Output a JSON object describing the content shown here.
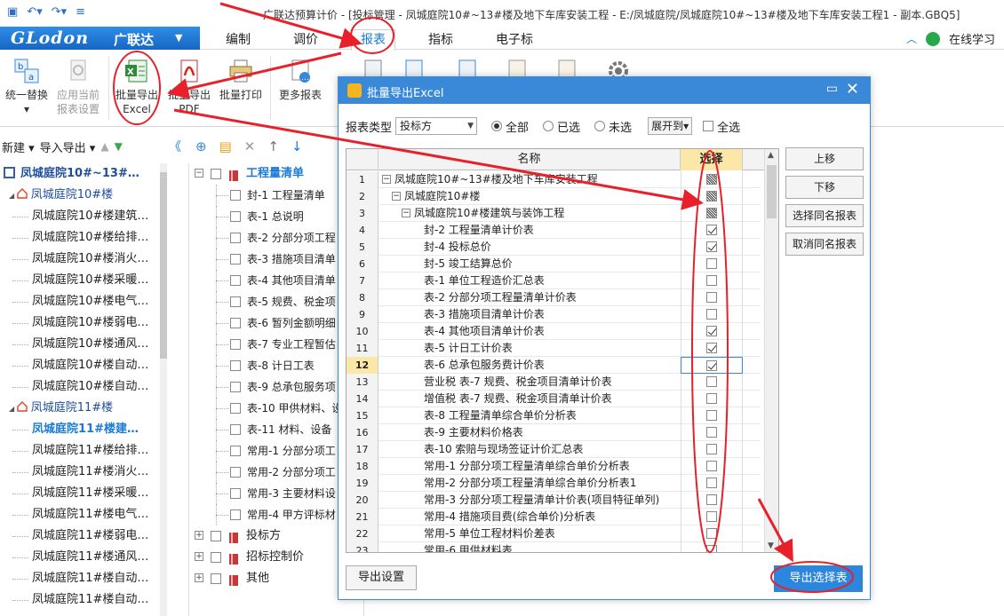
{
  "window": {
    "title": "广联达预算计价 - [投标管理 - 凤城庭院10#~13#楼及地下车库安装工程 - E:/凤城庭院/凤城庭院10#~13#楼及地下车库安装工程1 - 副本.GBQ5]"
  },
  "brand": {
    "logo": "GLodon",
    "name": "广联达"
  },
  "menu": {
    "tabs": [
      "编制",
      "调价",
      "报表",
      "指标",
      "电子标"
    ],
    "active": "报表",
    "learn": "在线学习"
  },
  "ribbon": {
    "buttons": [
      {
        "label1": "统一替换",
        "label2": "▾"
      },
      {
        "label1": "应用当前",
        "label2": "报表设置"
      },
      {
        "label1": "批量导出",
        "label2": "Excel"
      },
      {
        "label1": "批量导出",
        "label2": "PDF"
      },
      {
        "label1": "批量打印",
        "label2": ""
      },
      {
        "label1": "更多报表",
        "label2": ""
      }
    ]
  },
  "left_toolbar": {
    "new": "新建 ▾",
    "import_export": "导入导出 ▾"
  },
  "left_tree": [
    {
      "level": 0,
      "label": "凤城庭院10#~13#…"
    },
    {
      "level": 1,
      "label": "凤城庭院10#楼"
    },
    {
      "level": 2,
      "label": "凤城庭院10#楼建筑…"
    },
    {
      "level": 2,
      "label": "凤城庭院10#楼给排…"
    },
    {
      "level": 2,
      "label": "凤城庭院10#楼消火…"
    },
    {
      "level": 2,
      "label": "凤城庭院10#楼采暖…"
    },
    {
      "level": 2,
      "label": "凤城庭院10#楼电气…"
    },
    {
      "level": 2,
      "label": "凤城庭院10#楼弱电…"
    },
    {
      "level": 2,
      "label": "凤城庭院10#楼通风…"
    },
    {
      "level": 2,
      "label": "凤城庭院10#楼自动…"
    },
    {
      "level": 2,
      "label": "凤城庭院10#楼自动…"
    },
    {
      "level": 1,
      "label": "凤城庭院11#楼"
    },
    {
      "level": 2,
      "label": "凤城庭院11#楼建…",
      "selected": true
    },
    {
      "level": 2,
      "label": "凤城庭院11#楼给排…"
    },
    {
      "level": 2,
      "label": "凤城庭院11#楼消火…"
    },
    {
      "level": 2,
      "label": "凤城庭院11#楼采暖…"
    },
    {
      "level": 2,
      "label": "凤城庭院11#楼电气…"
    },
    {
      "level": 2,
      "label": "凤城庭院11#楼弱电…"
    },
    {
      "level": 2,
      "label": "凤城庭院11#楼通风…"
    },
    {
      "level": 2,
      "label": "凤城庭院11#楼自动…"
    },
    {
      "level": 2,
      "label": "凤城庭院11#楼自动…"
    }
  ],
  "mid_tree": [
    {
      "level": 0,
      "label": "工程量清单",
      "expanded": true,
      "highlight": true
    },
    {
      "level": 1,
      "label": "封-1 工程量清单"
    },
    {
      "level": 1,
      "label": "表-1 总说明"
    },
    {
      "level": 1,
      "label": "表-2 分部分项工程"
    },
    {
      "level": 1,
      "label": "表-3 措施项目清单"
    },
    {
      "level": 1,
      "label": "表-4 其他项目清单"
    },
    {
      "level": 1,
      "label": "表-5 规费、税金项"
    },
    {
      "level": 1,
      "label": "表-6 暂列金额明细"
    },
    {
      "level": 1,
      "label": "表-7 专业工程暂估"
    },
    {
      "level": 1,
      "label": "表-8 计日工表"
    },
    {
      "level": 1,
      "label": "表-9 总承包服务项"
    },
    {
      "level": 1,
      "label": "表-10 甲供材料、设"
    },
    {
      "level": 1,
      "label": "表-11 材料、设备"
    },
    {
      "level": 1,
      "label": "常用-1 分部分项工"
    },
    {
      "level": 1,
      "label": "常用-2 分部分项工"
    },
    {
      "level": 1,
      "label": "常用-3 主要材料设"
    },
    {
      "level": 1,
      "label": "常用-4 甲方评标材"
    },
    {
      "level": 0,
      "label": "投标方",
      "expanded": false
    },
    {
      "level": 0,
      "label": "招标控制价",
      "expanded": false
    },
    {
      "level": 0,
      "label": "其他",
      "expanded": false
    }
  ],
  "dialog": {
    "title": "批量导出Excel",
    "report_type_label": "报表类型",
    "report_type_value": "投标方",
    "radio_all": "全部",
    "radio_selected": "已选",
    "radio_unselected": "未选",
    "expand_to": "展开到",
    "select_all": "全选",
    "col_name": "名称",
    "col_select": "选择",
    "rows": [
      {
        "n": "1",
        "indent": 0,
        "pm": "−",
        "label": "凤城庭院10#~13#楼及地下车库安装工程",
        "state": "part"
      },
      {
        "n": "2",
        "indent": 1,
        "pm": "−",
        "label": "凤城庭院10#楼",
        "state": "part"
      },
      {
        "n": "3",
        "indent": 2,
        "pm": "−",
        "label": "凤城庭院10#楼建筑与装饰工程",
        "state": "part"
      },
      {
        "n": "4",
        "indent": 3,
        "label": "封-2 工程量清单计价表",
        "state": "on"
      },
      {
        "n": "5",
        "indent": 3,
        "label": "封-4 投标总价",
        "state": "on"
      },
      {
        "n": "6",
        "indent": 3,
        "label": "封-5 竣工结算总价",
        "state": "off"
      },
      {
        "n": "7",
        "indent": 3,
        "label": "表-1 单位工程造价汇总表",
        "state": "off"
      },
      {
        "n": "8",
        "indent": 3,
        "label": "表-2 分部分项工程量清单计价表",
        "state": "off"
      },
      {
        "n": "9",
        "indent": 3,
        "label": "表-3 措施项目清单计价表",
        "state": "off"
      },
      {
        "n": "10",
        "indent": 3,
        "label": "表-4 其他项目清单计价表",
        "state": "on"
      },
      {
        "n": "11",
        "indent": 3,
        "label": "表-5 计日工计价表",
        "state": "on"
      },
      {
        "n": "12",
        "indent": 3,
        "label": "表-6 总承包服务费计价表",
        "state": "on",
        "current": true
      },
      {
        "n": "13",
        "indent": 3,
        "label": "营业税 表-7 规费、税金项目清单计价表",
        "state": "off"
      },
      {
        "n": "14",
        "indent": 3,
        "label": "增值税 表-7 规费、税金项目清单计价表",
        "state": "off"
      },
      {
        "n": "15",
        "indent": 3,
        "label": "表-8 工程量清单综合单价分析表",
        "state": "off"
      },
      {
        "n": "16",
        "indent": 3,
        "label": "表-9 主要材料价格表",
        "state": "off"
      },
      {
        "n": "17",
        "indent": 3,
        "label": "表-10 索赔与现场签证计价汇总表",
        "state": "off"
      },
      {
        "n": "18",
        "indent": 3,
        "label": "常用-1 分部分项工程量清单综合单价分析表",
        "state": "off"
      },
      {
        "n": "19",
        "indent": 3,
        "label": "常用-2 分部分项工程量清单综合单价分析表1",
        "state": "off"
      },
      {
        "n": "20",
        "indent": 3,
        "label": "常用-3 分部分项工程量清单计价表(项目特征单列)",
        "state": "off"
      },
      {
        "n": "21",
        "indent": 3,
        "label": "常用-4 措施项目费(综合单价)分析表",
        "state": "off"
      },
      {
        "n": "22",
        "indent": 3,
        "label": "常用-5 单位工程材料价差表",
        "state": "off"
      },
      {
        "n": "23",
        "indent": 3,
        "label": "常用-6 甲供材料表",
        "state": "off"
      }
    ],
    "side_buttons": [
      "上移",
      "下移",
      "选择同名报表",
      "取消同名报表"
    ],
    "btn_settings": "导出设置",
    "btn_export": "导出选择表"
  },
  "colors": {
    "accent": "#1a7ad6",
    "annotation": "#e8202a",
    "header_select": "#fbe8a8"
  }
}
